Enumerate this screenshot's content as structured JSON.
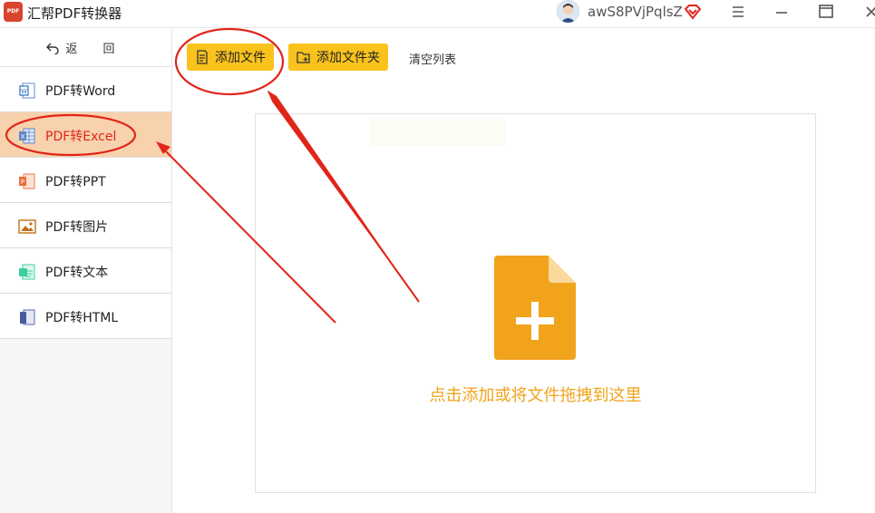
{
  "titlebar": {
    "app_title": "汇帮PDF转换器",
    "logo_text": "PDF",
    "username": "awS8PVjPqlsZ"
  },
  "sidebar": {
    "back_label": "返 回",
    "items": [
      {
        "label": "PDF转Word",
        "icon": "word-icon",
        "active": false
      },
      {
        "label": "PDF转Excel",
        "icon": "excel-icon",
        "active": true
      },
      {
        "label": "PDF转PPT",
        "icon": "ppt-icon",
        "active": false
      },
      {
        "label": "PDF转图片",
        "icon": "image-icon",
        "active": false
      },
      {
        "label": "PDF转文本",
        "icon": "text-icon",
        "active": false
      },
      {
        "label": "PDF转HTML",
        "icon": "html-icon",
        "active": false
      }
    ]
  },
  "toolbar": {
    "add_file_label": "添加文件",
    "add_folder_label": "添加文件夹",
    "clear_list_label": "清空列表"
  },
  "dropzone": {
    "hint": "点击添加或将文件拖拽到这里"
  },
  "colors": {
    "accent": "#f9c21d",
    "active_bg": "#f8d1ad",
    "active_text": "#e0251a",
    "hint": "#f1a31b",
    "annotation": "#e0251a"
  }
}
